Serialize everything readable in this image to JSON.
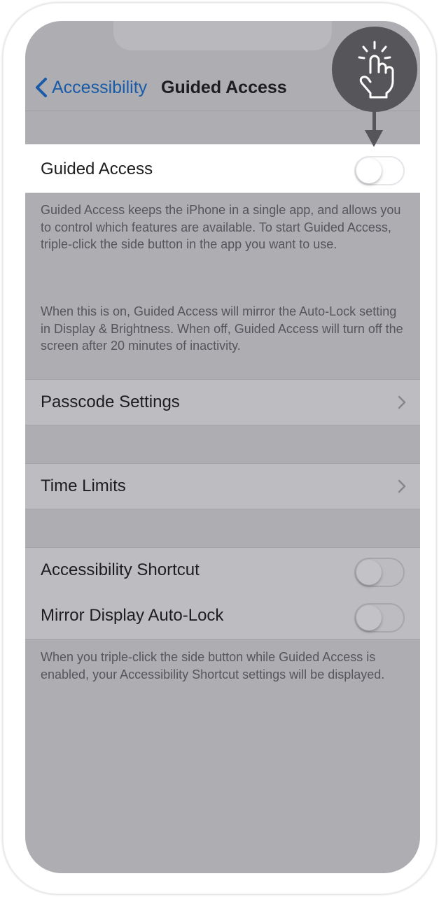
{
  "nav": {
    "back_label": "Accessibility",
    "title": "Guided Access"
  },
  "settings": {
    "guided_access": {
      "label": "Guided Access",
      "toggle_on": false
    },
    "description_1": "Guided Access keeps the iPhone in a single app, and allows you to control which features are available. To start Guided Access, triple-click the side button in the app you want to use.",
    "description_2": "When this is on, Guided Access will mirror the Auto-Lock setting in Display & Brightness. When off, Guided Access will turn off the screen after 20 minutes of inactivity.",
    "passcode_settings": {
      "label": "Passcode Settings"
    },
    "time_limits": {
      "label": "Time Limits"
    },
    "accessibility_shortcut": {
      "label": "Accessibility Shortcut",
      "toggle_on": false
    },
    "mirror_display_auto_lock": {
      "label": "Mirror Display Auto-Lock",
      "toggle_on": false
    },
    "description_3": "When you triple-click the side button while Guided Access is enabled, your Accessibility Shortcut settings will be displayed."
  },
  "overlay": {
    "icon": "tap-gesture-icon",
    "pointer": "arrow-down-icon"
  },
  "colors": {
    "screen_dim": "#adadb2",
    "link_blue": "#1a5ba8",
    "highlight_row": "#ffffff",
    "badge": "#56565a"
  }
}
